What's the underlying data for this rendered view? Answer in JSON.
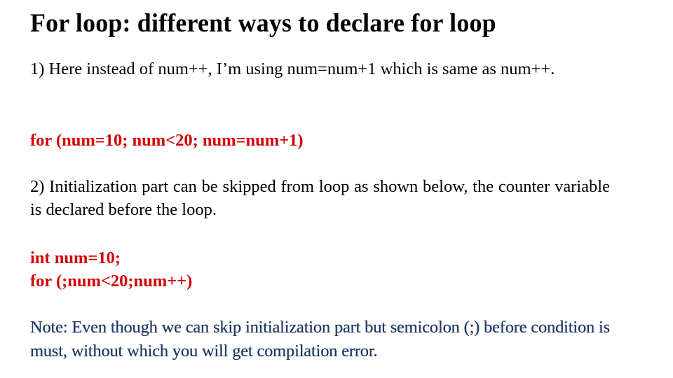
{
  "slide": {
    "title": "For loop: different ways to declare for loop",
    "point1": "1) Here instead of num++, I’m using num=num+1 which is same as num++.",
    "code1": "for (num=10; num<20; num=num+1)",
    "point2": "2) Initialization part can be skipped from loop as shown below, the counter variable is declared before the loop.",
    "code2": [
      "int num=10;",
      "for (;num<20;num++)"
    ],
    "note": "Note: Even though we can skip initialization part but semicolon (;) before condition is must, without which you will get compilation error."
  },
  "colors": {
    "code": "#d40000",
    "note": "#1f3864",
    "text": "#000000"
  }
}
